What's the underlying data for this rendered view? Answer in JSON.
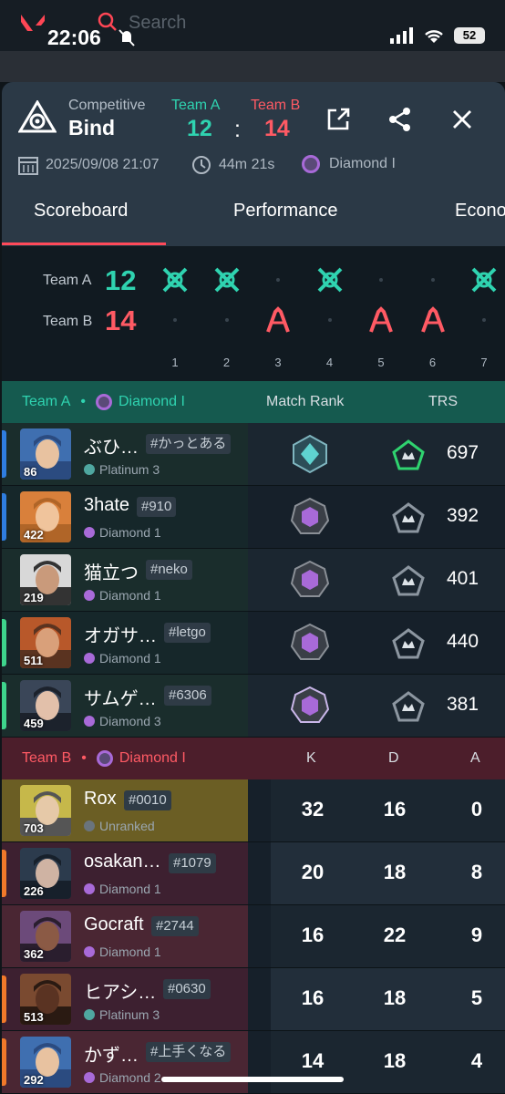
{
  "status_bar": {
    "time": "22:06",
    "battery": "52",
    "search_placeholder": "Search"
  },
  "match": {
    "mode": "Competitive",
    "map": "Bind",
    "team_a_label": "Team A",
    "team_b_label": "Team B",
    "team_a_score": "12",
    "team_b_score": "14",
    "colon": ":",
    "date": "2025/09/08 21:07",
    "duration": "44m 21s",
    "avg_rank": "Diamond I"
  },
  "tabs": [
    "Scoreboard",
    "Performance",
    "Econo"
  ],
  "rounds": {
    "team_a_label": "Team A",
    "team_b_label": "Team B",
    "team_a_score": "12",
    "team_b_score": "14",
    "numbers": [
      "1",
      "2",
      "3",
      "4",
      "5",
      "6",
      "7"
    ],
    "winners": [
      "A",
      "A",
      "B",
      "A",
      "B",
      "B",
      "A"
    ]
  },
  "team_a": {
    "label": "Team A",
    "separator": "•",
    "rank": "Diamond I",
    "col_match_rank": "Match Rank",
    "col_trs": "TRS",
    "players": [
      {
        "name": "ぶひ…",
        "tag": "#かっとある",
        "rank": "Platinum 3",
        "level": "86",
        "trs": "697",
        "edge": "#2f7de0",
        "gem": "#4fa7a0",
        "match_rank": "platinum",
        "trs_tier": "green"
      },
      {
        "name": "3hate",
        "tag": "#910",
        "rank": "Diamond 1",
        "level": "422",
        "trs": "392",
        "edge": "#2f7de0",
        "gem": "#a86ad8",
        "match_rank": "diamond",
        "trs_tier": "gray"
      },
      {
        "name": "猫立つ",
        "tag": "#neko",
        "rank": "Diamond 1",
        "level": "219",
        "trs": "401",
        "edge": "",
        "gem": "#a86ad8",
        "match_rank": "diamond",
        "trs_tier": "gray"
      },
      {
        "name": "オガサ…",
        "tag": "#letgo",
        "rank": "Diamond 1",
        "level": "511",
        "trs": "440",
        "edge": "#3ed48c",
        "gem": "#a86ad8",
        "match_rank": "diamond",
        "trs_tier": "gray"
      },
      {
        "name": "サムゲ…",
        "tag": "#6306",
        "rank": "Diamond 3",
        "level": "459",
        "trs": "381",
        "edge": "#3ed48c",
        "gem": "#a86ad8",
        "match_rank": "diamond3",
        "trs_tier": "gray"
      }
    ]
  },
  "team_b": {
    "label": "Team B",
    "separator": "•",
    "rank": "Diamond I",
    "col_k": "K",
    "col_d": "D",
    "col_a": "A",
    "players": [
      {
        "name": "Rox",
        "tag": "#0010",
        "rank": "Unranked",
        "level": "703",
        "k": "32",
        "d": "16",
        "a": "0",
        "edge": "",
        "gem": "#6a747d"
      },
      {
        "name": "osakan…",
        "tag": "#1079",
        "rank": "Diamond 1",
        "level": "226",
        "k": "20",
        "d": "18",
        "a": "8",
        "edge": "#f0792a",
        "gem": "#a86ad8"
      },
      {
        "name": "Gocraft",
        "tag": "#2744",
        "rank": "Diamond 1",
        "level": "362",
        "k": "16",
        "d": "22",
        "a": "9",
        "edge": "",
        "gem": "#a86ad8"
      },
      {
        "name": "ヒアシ…",
        "tag": "#0630",
        "rank": "Platinum 3",
        "level": "513",
        "k": "16",
        "d": "18",
        "a": "5",
        "edge": "#f0792a",
        "gem": "#4fa7a0"
      },
      {
        "name": "かず…",
        "tag": "#上手くなる",
        "rank": "Diamond 2",
        "level": "292",
        "k": "14",
        "d": "18",
        "a": "4",
        "edge": "#f0792a",
        "gem": "#a86ad8"
      }
    ]
  },
  "colors": {
    "team_a": "#2fd3b0",
    "team_b": "#ff5a64",
    "accent": "#ff4a5a",
    "header_bg": "#2b3946"
  }
}
